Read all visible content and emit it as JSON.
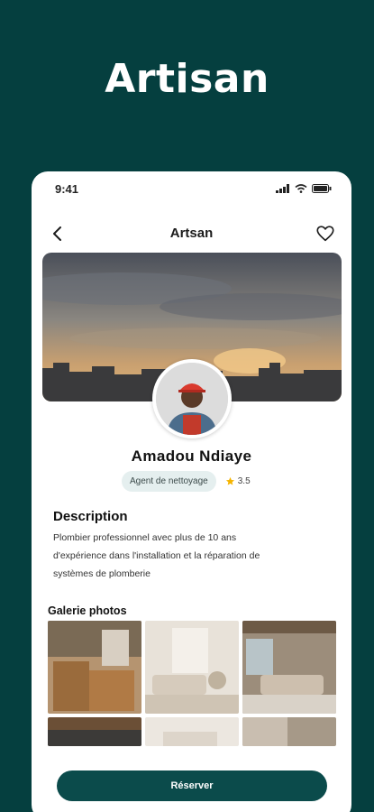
{
  "promo": {
    "title": "Artisan"
  },
  "status_bar": {
    "time": "9:41"
  },
  "nav": {
    "title": "Artsan"
  },
  "profile": {
    "name": "Amadou Ndiaye",
    "role": "Agent de nettoyage",
    "rating": "3.5"
  },
  "description": {
    "title": "Description",
    "lines": [
      "Plombier professionnel avec plus de 10 ans",
      "d'expérience dans l'installation et la réparation de",
      "systèmes de plomberie"
    ]
  },
  "gallery": {
    "title": "Galerie photos"
  },
  "cta": {
    "label": "Réserver"
  },
  "colors": {
    "background": "#053f3f",
    "accent": "#0b4b4b",
    "badge": "#e5efef",
    "star": "#f5b400"
  }
}
